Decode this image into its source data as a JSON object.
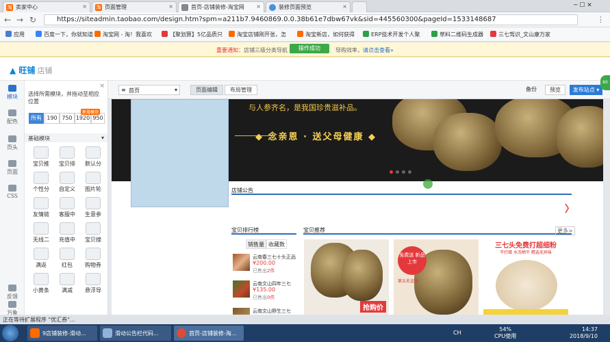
{
  "browser_tabs": [
    {
      "label": "卖家中心",
      "icon": "taobao-icon"
    },
    {
      "label": "页面管理",
      "icon": "taobao-icon"
    },
    {
      "label": "首页-店铺装修-淘宝网",
      "icon": "page-icon"
    },
    {
      "label": "装修页面预览",
      "icon": "loading-icon"
    }
  ],
  "address": {
    "url": "https://siteadmin.taobao.com/design.htm?spm=a211b7.9460869.0.0.38b61e7dbw67vk&sid=445560300&pageId=1533148687"
  },
  "bookmarks": [
    {
      "label": "应用",
      "color": "#4a7fd0"
    },
    {
      "label": "百度一下，你就知道",
      "color": "#3385ff"
    },
    {
      "label": "淘宝网 - 淘！我喜欢",
      "color": "#ff6a00"
    },
    {
      "label": "【聚划算】5亿品质只",
      "color": "#e4393c"
    },
    {
      "label": "淘宝店铺刚开张，怎",
      "color": "#ff6a00"
    },
    {
      "label": "淘宝新店，如何获得",
      "color": "#ff6a00"
    },
    {
      "label": "ERP技术开发个人聚",
      "color": "#2aa146"
    },
    {
      "label": "草料二维码生成器",
      "color": "#2aa146"
    },
    {
      "label": "三七驾识_文山康万家",
      "color": "#e4393c"
    }
  ],
  "notice": {
    "prefix": "重要通知：",
    "text": "店铺三级分类导航",
    "middle": "操作成功",
    "tail": "导购效率，",
    "link": "请点击查看»"
  },
  "header": {
    "logo": "旺铺",
    "sub": "店铺"
  },
  "rail": [
    {
      "label": "模块",
      "icon": "module-icon"
    },
    {
      "label": "配色",
      "icon": "palette-icon"
    },
    {
      "label": "页头",
      "icon": "header-icon"
    },
    {
      "label": "页面",
      "icon": "page-layout-icon"
    },
    {
      "label": "CSS",
      "icon": "code-icon"
    },
    {
      "label": "反馈",
      "icon": "feedback-icon"
    },
    {
      "label": "万象",
      "icon": "wanxiang-icon"
    }
  ],
  "panel": {
    "hint": "选择所需模块，并拖动至相应位置",
    "widths": [
      "所有",
      "190",
      "750",
      "1920",
      "950"
    ],
    "hot_badge": "新增模块",
    "section": "基础模块",
    "modules": [
      {
        "label": "宝贝推",
        "icon": "promo-icon"
      },
      {
        "label": "宝贝排",
        "icon": "ranking-icon"
      },
      {
        "label": "默认分",
        "icon": "category-icon"
      },
      {
        "label": "个性分",
        "icon": "custom-category-icon"
      },
      {
        "label": "自定义",
        "icon": "custom-icon"
      },
      {
        "label": "图片轮",
        "icon": "carousel-icon"
      },
      {
        "label": "友情链",
        "icon": "link-icon"
      },
      {
        "label": "客服中",
        "icon": "service-icon"
      },
      {
        "label": "生意参",
        "icon": "business-icon"
      },
      {
        "label": "无线二",
        "icon": "qr-icon"
      },
      {
        "label": "充值中",
        "icon": "recharge-icon"
      },
      {
        "label": "宝贝搜",
        "icon": "search-icon"
      },
      {
        "label": "满返",
        "icon": "rebate-icon"
      },
      {
        "label": "红包",
        "icon": "redpacket-icon"
      },
      {
        "label": "购物券",
        "icon": "coupon-icon"
      },
      {
        "label": "小黄条",
        "icon": "bar-icon"
      },
      {
        "label": "满减",
        "icon": "discount-icon"
      },
      {
        "label": "悬浮导",
        "icon": "float-nav-icon"
      }
    ]
  },
  "toolbar": {
    "page": "首页",
    "tab_edit": "页面编辑",
    "tab_layout": "布局管理",
    "backup": "备份",
    "preview": "预览",
    "publish": "发布站点"
  },
  "canvas": {
    "banner_top": "与人参齐名，是我国珍贵滋补品。",
    "slogan": "◆ 念亲恩 · 送父母健康 ◆",
    "notice_title": "店铺公告",
    "rank_title": "宝贝排行榜",
    "recommend_title": "宝贝推荐",
    "more": "更多>",
    "tab_sales": "销售量",
    "tab_fav": "收藏数",
    "rank_items": [
      {
        "name": "云南春三七十头正品",
        "price": "¥200.00",
        "sold_prefix": "已售出",
        "sold": "2件"
      },
      {
        "name": "云南文山四年三七",
        "price": "¥135.00",
        "sold_prefix": "已售出",
        "sold": "0件"
      },
      {
        "name": "云南文山野生三七",
        "price": "",
        "sold_prefix": "",
        "sold": ""
      }
    ],
    "products": [
      {
        "caption": "抢购价"
      },
      {
        "caption": "免费送 新品上市",
        "sub": "第五名送赠"
      },
      {
        "caption": "三七头免费打超细粉",
        "sub": "不打蜡 水洗晒干 精选无异味"
      }
    ]
  },
  "status": "正在等待扩展程序 \"优汇券\"...",
  "taskbar": [
    {
      "label": "9店铺装修-滑动...",
      "color": "#ff6a00"
    },
    {
      "label": "滑动公告栏代码...",
      "color": "#8fb3d9"
    },
    {
      "label": "首页-店铺装修-淘...",
      "color": "#dd4b39"
    }
  ],
  "tray": {
    "cpu": "54%",
    "cpu_label": "CPU使用",
    "time": "14:37",
    "date": "2018/9/10",
    "ime": "CH"
  }
}
